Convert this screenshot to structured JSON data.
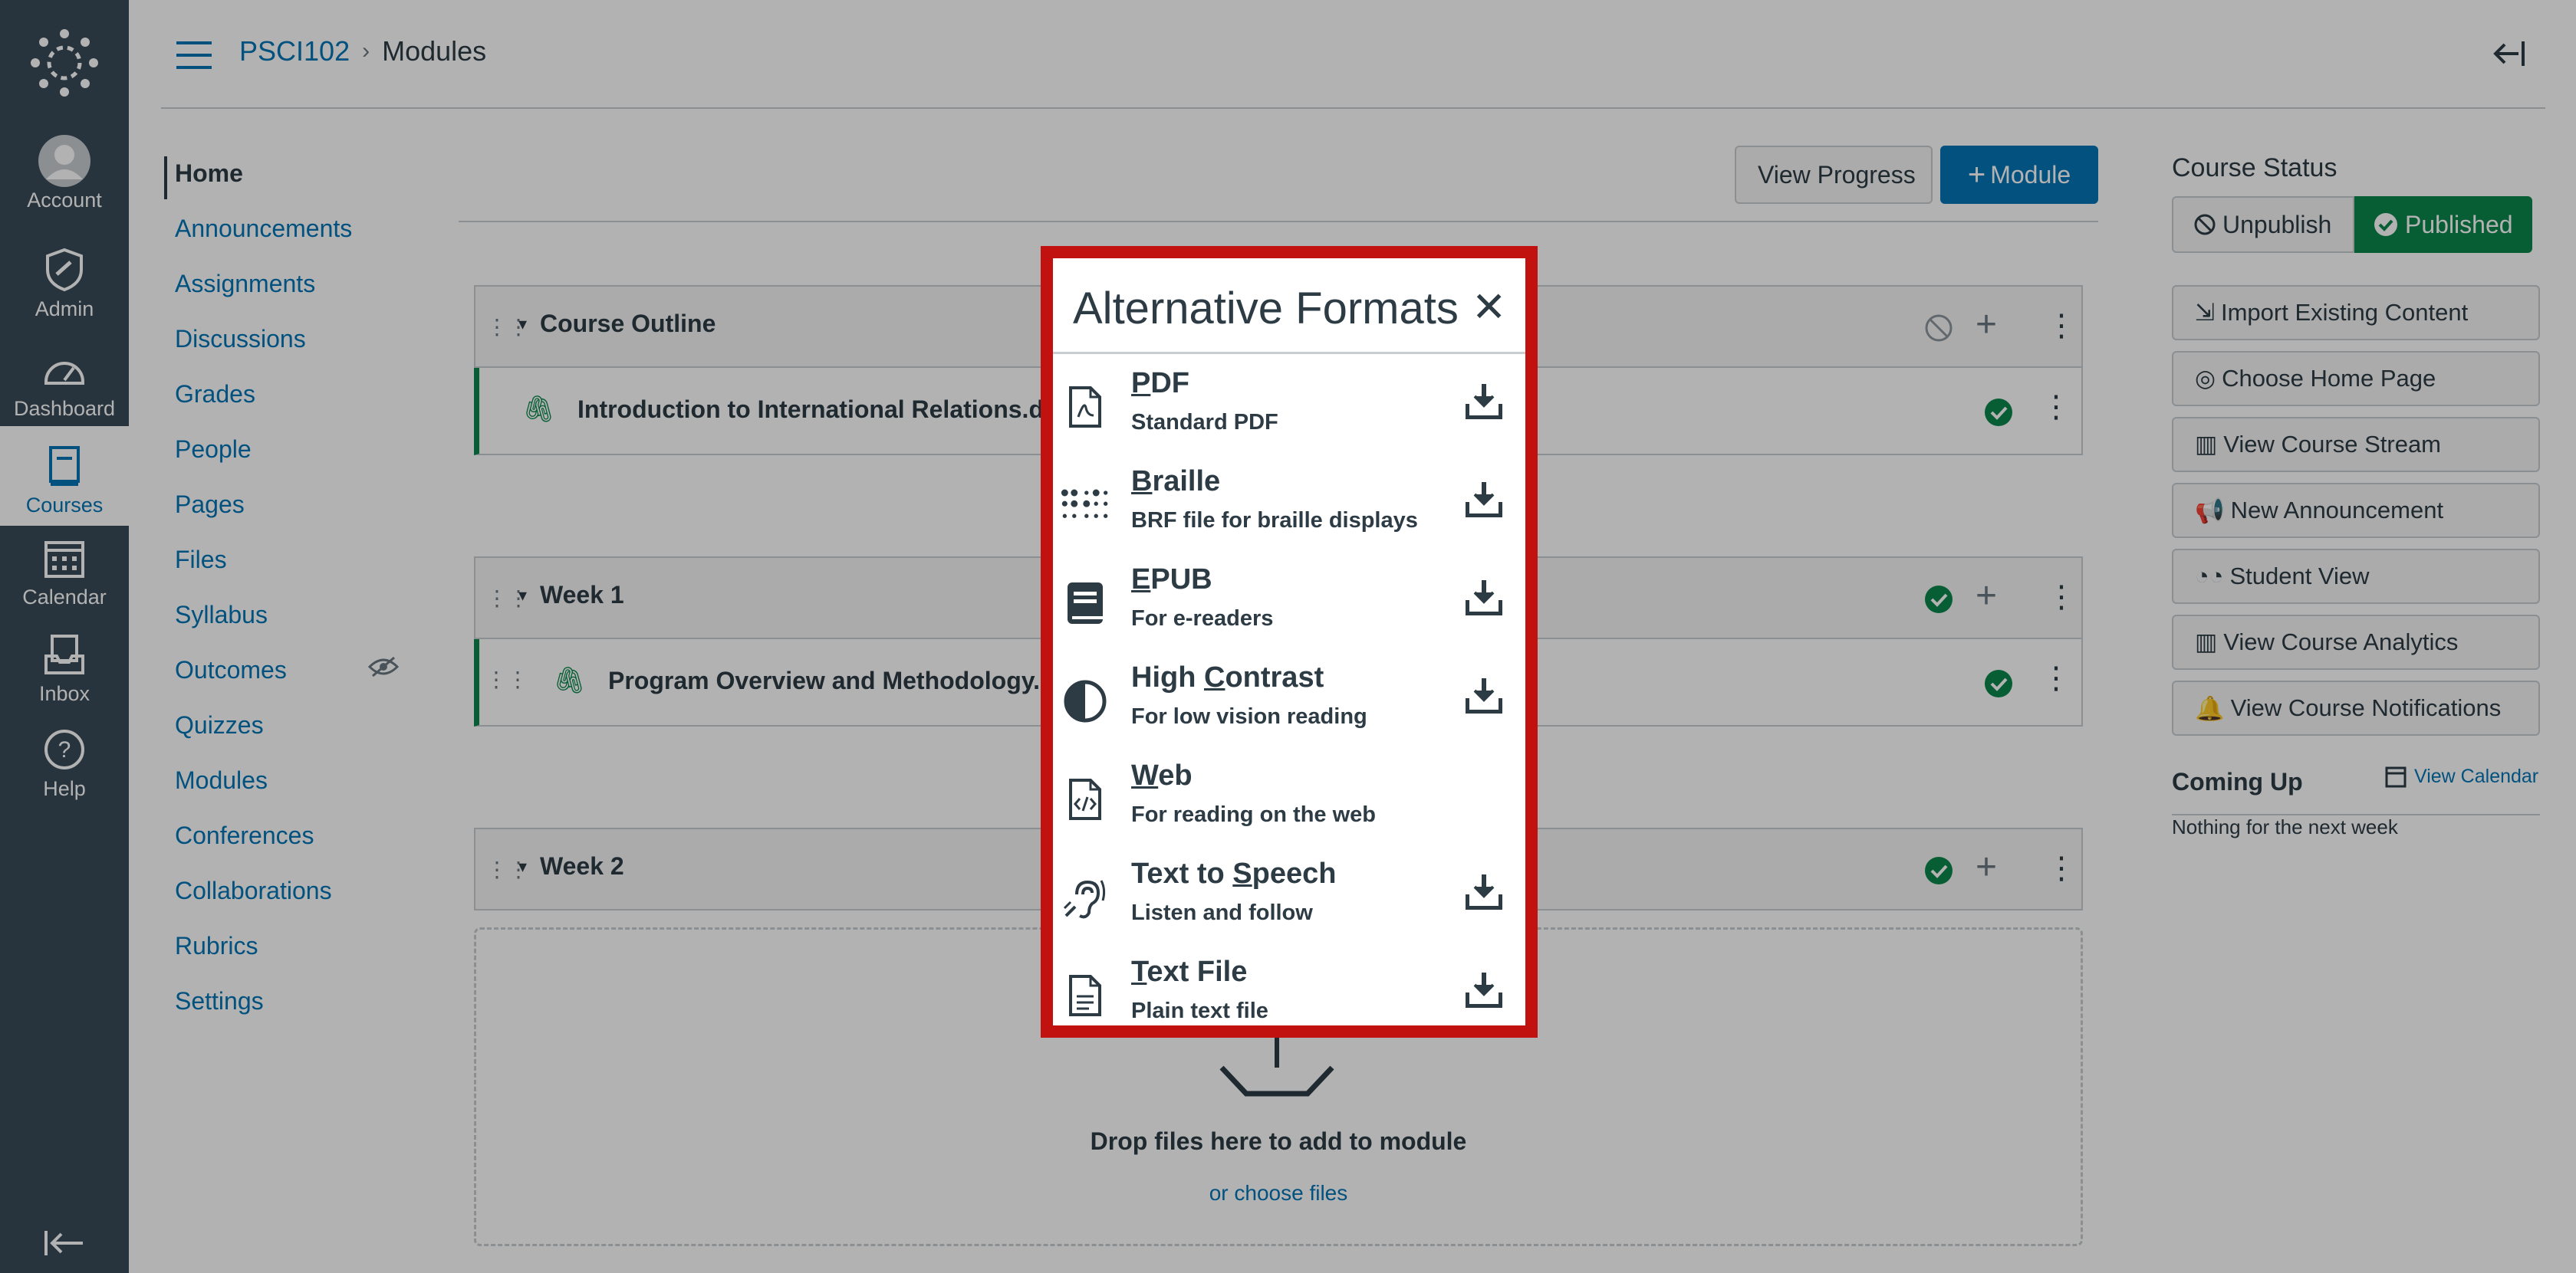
{
  "global_nav": {
    "items": [
      {
        "label": "Account",
        "icon": "account-icon"
      },
      {
        "label": "Admin",
        "icon": "admin-icon"
      },
      {
        "label": "Dashboard",
        "icon": "dashboard-icon"
      },
      {
        "label": "Courses",
        "icon": "courses-icon",
        "active": true
      },
      {
        "label": "Calendar",
        "icon": "calendar-icon"
      },
      {
        "label": "Inbox",
        "icon": "inbox-icon"
      },
      {
        "label": "Help",
        "icon": "help-icon"
      }
    ]
  },
  "header": {
    "course_code": "PSCI102",
    "separator": "›",
    "current_page": "Modules"
  },
  "course_nav": {
    "items": [
      "Home",
      "Announcements",
      "Assignments",
      "Discussions",
      "Grades",
      "People",
      "Pages",
      "Files",
      "Syllabus",
      "Outcomes",
      "Quizzes",
      "Modules",
      "Conferences",
      "Collaborations",
      "Rubrics",
      "Settings"
    ]
  },
  "toolbar": {
    "view_progress": "View Progress",
    "add_module": "Module",
    "add_module_prefix": "+"
  },
  "modules": [
    {
      "title": "Course Outline",
      "item": "Introduction to International Relations.doc"
    },
    {
      "title": "Week 1",
      "item": "Program Overview and Methodology.doc"
    },
    {
      "title": "Week 2"
    }
  ],
  "dropzone": {
    "text": "Drop files here to add to module",
    "link": "or choose files"
  },
  "course_status": {
    "heading": "Course Status",
    "unpublish": "Unpublish",
    "published": "Published",
    "buttons": [
      "Import Existing Content",
      "Choose Home Page",
      "View Course Stream",
      "New Announcement",
      "Student View",
      "View Course Analytics",
      "View Course Notifications"
    ],
    "coming_up_heading": "Coming Up",
    "view_calendar": "View Calendar",
    "coming_up_empty": "Nothing for the next week"
  },
  "modal": {
    "title": "Alternative Formats",
    "close": "✕",
    "formats": [
      {
        "first": "P",
        "rest": "DF",
        "desc": "Standard PDF",
        "icon": "pdf-icon",
        "download": true
      },
      {
        "first": "B",
        "rest": "raille",
        "desc": "BRF file for braille displays",
        "icon": "braille-icon",
        "download": true
      },
      {
        "first": "E",
        "rest": "PUB",
        "desc": "For e-readers",
        "icon": "epub-icon",
        "download": true
      },
      {
        "pre": "High ",
        "first": "C",
        "rest": "ontrast",
        "desc": "For low vision reading",
        "icon": "contrast-icon",
        "download": true
      },
      {
        "first": "W",
        "rest": "eb",
        "desc": "For reading on the web",
        "icon": "web-icon",
        "download": false
      },
      {
        "pre": "Text to ",
        "first": "S",
        "rest": "peech",
        "desc": "Listen and follow",
        "icon": "speech-icon",
        "download": true
      },
      {
        "first": "T",
        "rest": "ext File",
        "desc": "Plain text file",
        "icon": "text-file-icon",
        "download": true
      }
    ]
  },
  "colors": {
    "nav_bg": "#394b58",
    "link": "#0374b5",
    "published": "#0b874b",
    "modal_border": "#c1120f"
  }
}
